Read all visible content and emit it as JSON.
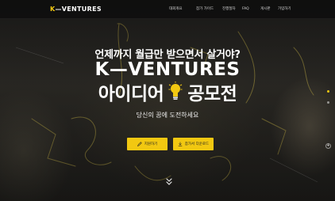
{
  "header": {
    "logo_k": "K",
    "logo_rest": "—VENTURES",
    "nav": [
      "대회개요",
      "참가 가이드",
      "진행절차",
      "FAQ",
      "게시판",
      "가입하기"
    ]
  },
  "hero": {
    "subtitle": "언제까지 월급만 받으면서 살거야?",
    "brand": "K—VENTURES",
    "contest_left": "아이디어",
    "contest_right": "공모전",
    "tagline": "당신의 꿈에 도전하세요"
  },
  "buttons": {
    "apply": "지원하기",
    "download": "참가서 다운로드"
  },
  "icons": {
    "apply": "pencil-icon",
    "download": "download-icon",
    "bulb": "lightbulb-icon",
    "scroll": "chevron-down-double-icon"
  },
  "colors": {
    "accent": "#f2c811",
    "text": "#ffffff",
    "topbar": "#0c0c0c"
  }
}
